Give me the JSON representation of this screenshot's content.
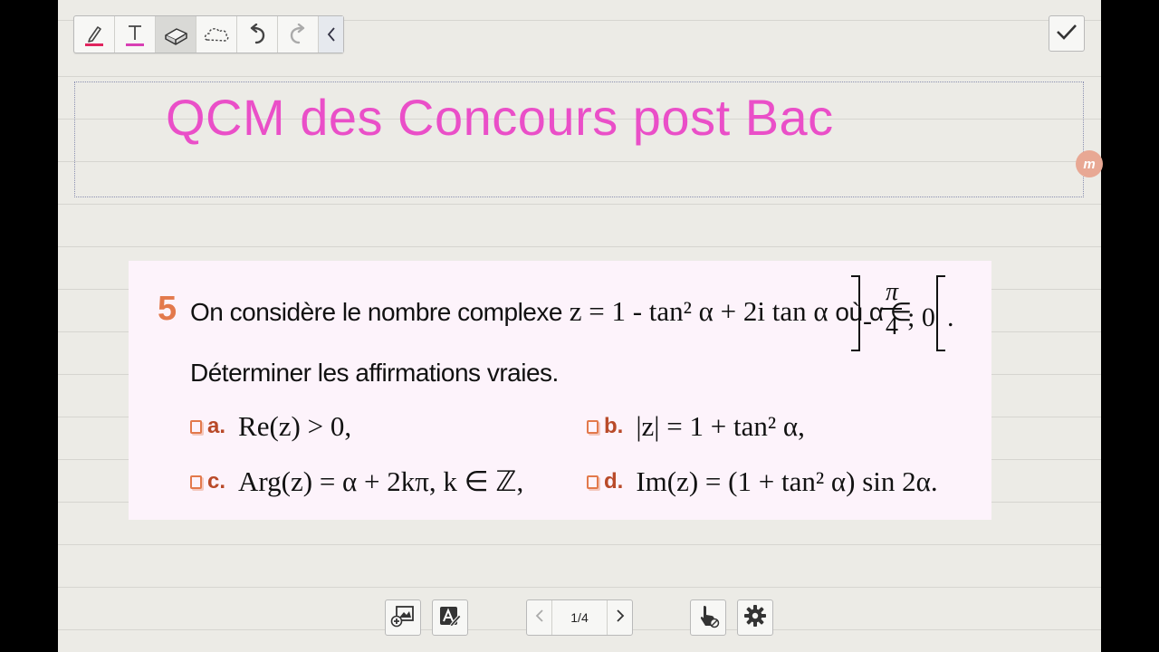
{
  "toolbar": {
    "tools": [
      {
        "name": "pen",
        "icon": "pen-icon"
      },
      {
        "name": "text",
        "icon": "text-tool-icon",
        "glyph": "T"
      },
      {
        "name": "eraser",
        "icon": "eraser-icon",
        "active": true
      },
      {
        "name": "lasso",
        "icon": "lasso-icon"
      },
      {
        "name": "undo",
        "icon": "undo-icon"
      },
      {
        "name": "redo",
        "icon": "redo-icon"
      },
      {
        "name": "collapse",
        "icon": "chevron-left-icon"
      }
    ],
    "done_icon": "checkmark-icon"
  },
  "colors": {
    "pen_underline": "#e0245e",
    "text_underline": "#d83fb4",
    "title": "#ea4fc8",
    "question_accent": "#e3794c"
  },
  "title": "QCM des Concours post Bac",
  "problem": {
    "number": "5",
    "statement": {
      "lead": "On considère le nombre complexe",
      "formula": "z = 1 - tan² α + 2i tan α",
      "mid": "où α ∈",
      "interval": {
        "minus": "-",
        "numerator": "π",
        "denominator": "4",
        "after": "; 0",
        "end": "."
      }
    },
    "instruction": "Déterminer les affirmations vraies.",
    "options": [
      {
        "letter": "a.",
        "text": "Re(z) > 0,"
      },
      {
        "letter": "b.",
        "text": "|z| = 1 + tan² α,"
      },
      {
        "letter": "c.",
        "text": "Arg(z) = α + 2kπ,  k ∈ ℤ,"
      },
      {
        "letter": "d.",
        "text": "Im(z) = (1 + tan² α) sin 2α."
      }
    ]
  },
  "side_handle": "m",
  "bottom_bar": {
    "insert_image_icon": "insert-image-icon",
    "text_recognition_icon": "text-recognition-icon",
    "page_indicator": "1/4",
    "touch_icon": "touch-pointer-icon",
    "settings_icon": "gear-icon"
  }
}
